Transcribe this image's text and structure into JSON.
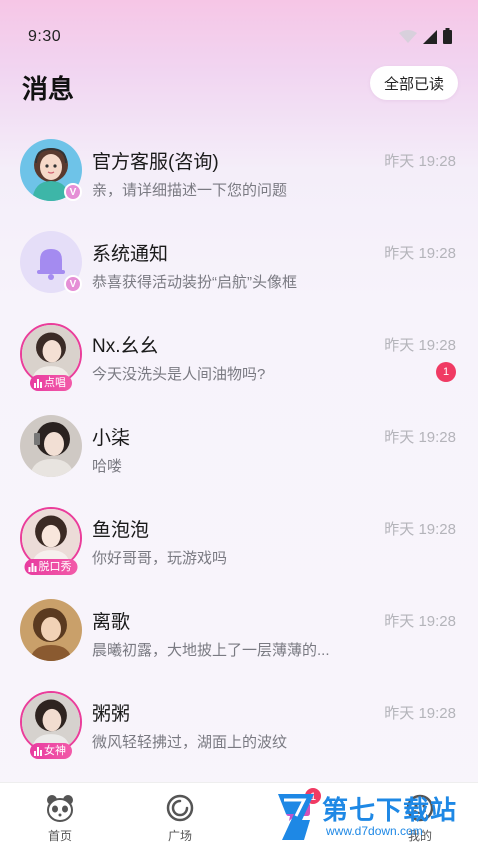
{
  "status_bar": {
    "time": "9:30"
  },
  "header": {
    "title": "消息",
    "mark_all_read": "全部已读"
  },
  "messages": [
    {
      "name": "官方客服(咨询)",
      "preview": "亲，请详细描述一下您的问题",
      "time": "昨天 19:28",
      "verified": true,
      "tag": "",
      "unread": ""
    },
    {
      "name": "系统通知",
      "preview": "恭喜获得活动装扮“启航”头像框",
      "time": "昨天 19:28",
      "verified": true,
      "tag": "",
      "unread": ""
    },
    {
      "name": "Nx.幺幺",
      "preview": "今天没洗头是人间油物吗?",
      "time": "昨天 19:28",
      "verified": false,
      "tag": "点唱",
      "unread": "1"
    },
    {
      "name": "小柒",
      "preview": "哈喽",
      "time": "昨天 19:28",
      "verified": false,
      "tag": "",
      "unread": ""
    },
    {
      "name": "鱼泡泡",
      "preview": "你好哥哥，玩游戏吗",
      "time": "昨天 19:28",
      "verified": false,
      "tag": "脱口秀",
      "unread": ""
    },
    {
      "name": "离歌",
      "preview": "晨曦初露，大地披上了一层薄薄的...",
      "time": "昨天 19:28",
      "verified": false,
      "tag": "",
      "unread": ""
    },
    {
      "name": "粥粥",
      "preview": "微风轻轻拂过，湖面上的波纹",
      "time": "昨天 19:28",
      "verified": false,
      "tag": "女神",
      "unread": ""
    }
  ],
  "tab_bar": {
    "tabs": [
      {
        "label": "首页",
        "icon": "panda-icon"
      },
      {
        "label": "广场",
        "icon": "circle-icon"
      },
      {
        "label": "",
        "icon": "message-icon",
        "badge": "1"
      },
      {
        "label": "我的",
        "icon": "smile-icon"
      }
    ]
  },
  "watermark": {
    "title": "第七下载站",
    "url": "www.d7down.com"
  },
  "colors": {
    "accent": "#ea3d9a",
    "badge": "#f03a63",
    "watermark": "#1e88e5"
  }
}
